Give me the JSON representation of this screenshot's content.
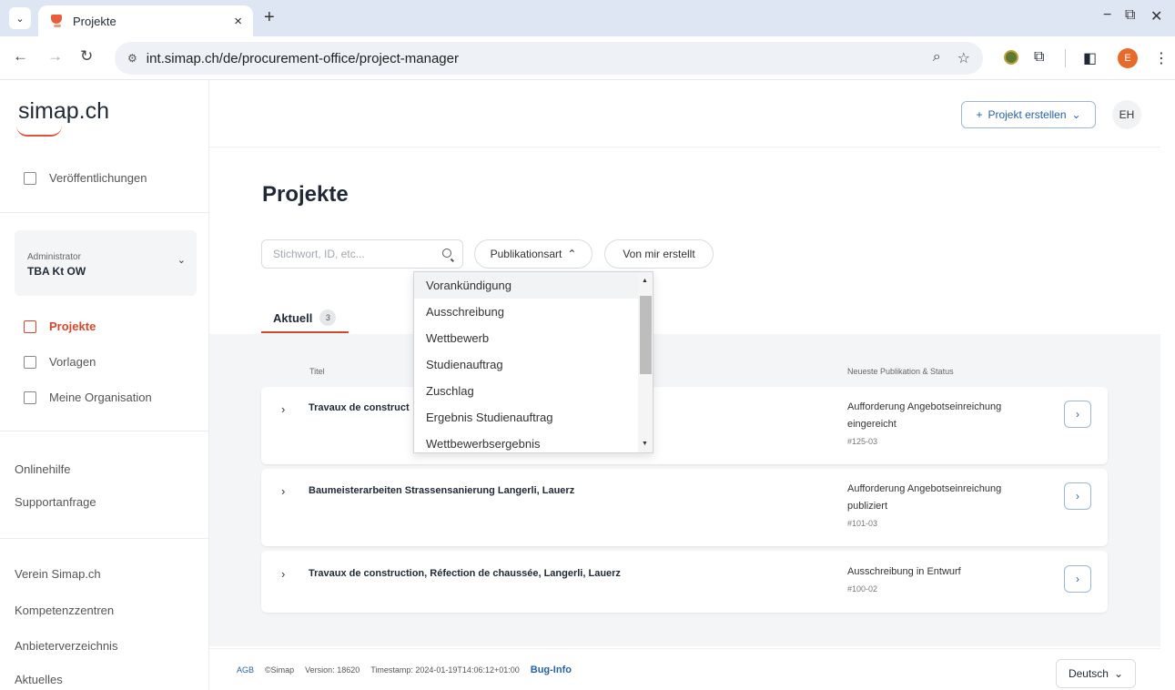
{
  "browser": {
    "tab_title": "Projekte",
    "tab_close": "×",
    "new_tab": "+",
    "url": "int.simap.ch/de/procurement-office/project-manager",
    "profile_initial": "E",
    "win_min": "−",
    "win_restore": "⧉",
    "win_close": "✕"
  },
  "sidebar": {
    "logo": "simap.ch",
    "publications": "Veröffentlichungen",
    "org_role": "Administrator",
    "org_name": "TBA Kt OW",
    "nav": [
      "Projekte",
      "Vorlagen",
      "Meine Organisation"
    ],
    "help": [
      "Onlinehilfe",
      "Supportanfrage"
    ],
    "links": [
      "Verein Simap.ch",
      "Kompetenzzentren",
      "Anbieterverzeichnis",
      "Aktuelles"
    ]
  },
  "header": {
    "create_project": "Projekt erstellen",
    "user_initials": "EH"
  },
  "main": {
    "title": "Projekte",
    "search_placeholder": "Stichwort, ID, etc...",
    "filter_publication": "Publikationsart",
    "filter_mine": "Von mir erstellt",
    "tab_current": "Aktuell",
    "tab_current_count": "3",
    "col_title": "Titel",
    "col_status": "Neueste Publikation & Status"
  },
  "rows": [
    {
      "title": "Travaux de construct",
      "status": "Aufforderung Angebotseinreichung eingereicht",
      "id": "#125-03"
    },
    {
      "title": "Baumeisterarbeiten Strassensanierung Langerli, Lauerz",
      "status": "Aufforderung Angebotseinreichung publiziert",
      "id": "#101-03"
    },
    {
      "title": "Travaux de construction, Réfection de chaussée, Langerli, Lauerz",
      "status": "Ausschreibung in Entwurf",
      "id": "#100-02"
    }
  ],
  "dropdown": {
    "options": [
      "Vorankündigung",
      "Ausschreibung",
      "Wettbewerb",
      "Studienauftrag",
      "Zuschlag",
      "Ergebnis Studienauftrag",
      "Wettbewerbsergebnis"
    ]
  },
  "footer": {
    "agb": "AGB",
    "copyright": "©Simap",
    "version": "Version: 18620",
    "timestamp": "Timestamp: 2024-01-19T14:06:12+01:00",
    "bug_info": "Bug-Info",
    "language": "Deutsch"
  },
  "colors": {
    "accent": "#d7462b",
    "link": "#2563a8"
  }
}
